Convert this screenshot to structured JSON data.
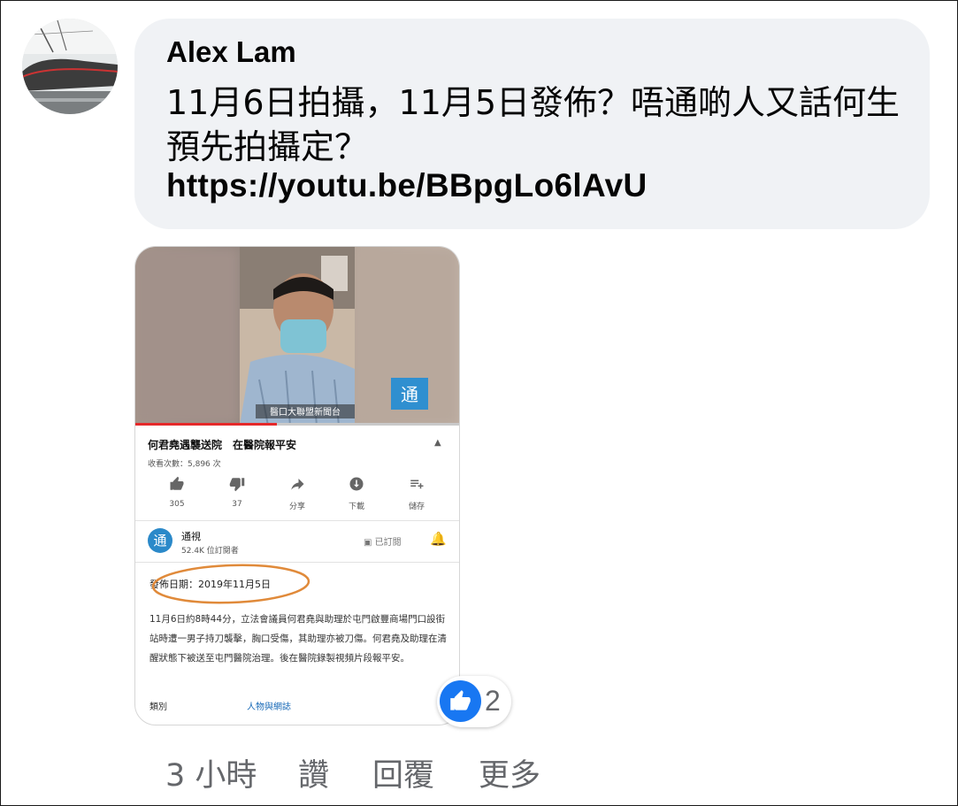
{
  "comment": {
    "author": "Alex Lam",
    "text": "11月6日拍攝，11月5日發佈？唔通啲人又話何生預先拍攝定？",
    "link": "https://youtu.be/BBpgLo6lAvU"
  },
  "screenshot": {
    "video_caption": "醫口大聯盟新聞台",
    "title": "何君堯遇襲送院　在醫院報平安",
    "views": "收看次數：5,896 次",
    "actions": [
      {
        "icon": "thumbs-up-icon",
        "label": "305"
      },
      {
        "icon": "thumbs-down-icon",
        "label": "37"
      },
      {
        "icon": "share-icon",
        "label": "分享"
      },
      {
        "icon": "download-icon",
        "label": "下載"
      },
      {
        "icon": "save-playlist-icon",
        "label": "儲存"
      }
    ],
    "channel": {
      "logo_text": "通",
      "name": "通視",
      "subscribers": "52.4K 位訂閱者",
      "subscribed": "已訂閱"
    },
    "publish_date": "發佈日期：2019年11月5日",
    "description": "11月6日約8時44分，立法會議員何君堯與助理於屯門啟豐商場門口設街站時遭一男子持刀襲擊，胸口受傷，其助理亦被刀傷。何君堯及助理在清醒狀態下被送至屯門醫院治理。後在醫院錄製視頻片段報平安。",
    "category_label": "類別",
    "category_value": "人物與網誌",
    "watermark": "通"
  },
  "reactions": {
    "type": "like",
    "count": "2"
  },
  "meta": {
    "time": "3 小時",
    "like": "讚",
    "reply": "回覆",
    "more": "更多"
  },
  "colors": {
    "bubble": "#f0f2f5",
    "like_blue": "#1877f2",
    "meta_gray": "#65676b",
    "annotation_circle": "#e08a3a"
  }
}
